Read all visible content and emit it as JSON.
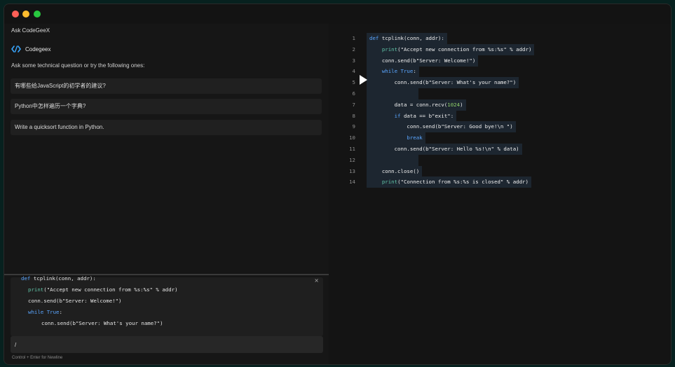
{
  "window": {
    "controls": [
      "close",
      "minimize",
      "maximize"
    ]
  },
  "panel": {
    "title": "Ask CodeGeeX",
    "brand_name": "Codegeex",
    "prompt": "Ask some technical question or try the following ones:",
    "suggestions": [
      "有哪些给JavaScript的初学者的建议?",
      "Python中怎样遍历一个字典?",
      "Write a quicksort function in Python."
    ],
    "snippet": {
      "lines": [
        "def tcplink(conn, addr):",
        "print(\"Accept new connection from %s:%s\" % addr)",
        "conn.send(b\"Server: Welcome!\")",
        "while True:",
        "conn.send(b\"Server: What's your name?\")"
      ]
    },
    "input_value": "/",
    "hint": "Control + Enter for Newline"
  },
  "editor": {
    "line_numbers": [
      "1",
      "2",
      "3",
      "4",
      "5",
      "6",
      "7",
      "8",
      "9",
      "10",
      "11",
      "12",
      "13",
      "14"
    ],
    "accent_keyword": "#5aa6ff",
    "accent_function": "#61c3a7"
  },
  "icons": {
    "brand": "codegeex-logo-icon",
    "close": "close-icon",
    "cursor": "mouse-cursor-icon"
  }
}
